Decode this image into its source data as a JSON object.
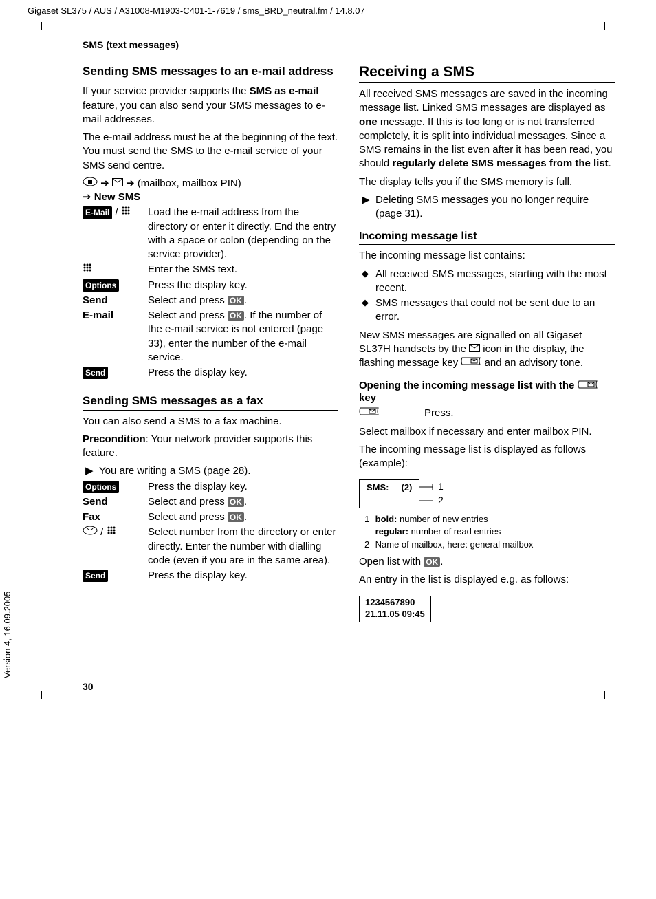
{
  "meta": {
    "path": "Gigaset SL375 / AUS / A31008-M1903-C401-1-7619 / sms_BRD_neutral.fm / 14.8.07",
    "version": "Version 4, 16.09.2005",
    "page_number": "30",
    "section": "SMS (text messages)"
  },
  "left": {
    "h2a": "Sending SMS messages to an e-mail address",
    "p1a": "If your service provider supports the ",
    "p1b": "SMS as e-mail",
    "p1c": " feature, you can also send your SMS messages to e-mail addresses.",
    "p2": "The e-mail address must be at the beginning of the text. You must send the SMS to the e-mail service of your SMS send centre.",
    "nav1": "(mailbox, mailbox PIN)",
    "nav2": "New SMS",
    "email_key": "E-Mail",
    "step1": "Load the e-mail address from the directory or enter it directly. End the entry with a space or colon (depending on the service provider).",
    "step2_label": "",
    "step2": "Enter the SMS text.",
    "step3_label": "Options",
    "step3": "Press the display key.",
    "step4_label": "Send",
    "step4a": "Select and press ",
    "step4b": ".",
    "step5_label": "E-mail",
    "step5a": "Select and press ",
    "step5b": ". If the number of the e-mail service is not entered (page 33), enter the number of the e-mail service.",
    "step6_label": "Send",
    "step6": "Press the display key.",
    "h2b": "Sending SMS messages as a fax",
    "p3": "You can also send a SMS to a fax machine.",
    "p4a": "Precondition",
    "p4b": ": Your network provider supports this feature.",
    "bullet1": "You are writing a SMS (page 28).",
    "fstep1_label": "Options",
    "fstep1": "Press the display key.",
    "fstep2_label": "Send",
    "fstep2a": "Select and press ",
    "fstep2b": ".",
    "fstep3_label": "Fax",
    "fstep3a": "Select and press ",
    "fstep3b": ".",
    "fstep4": "Select number from the directory or enter directly. Enter the number with dialling code (even if you are in the same area).",
    "fstep5_label": "Send",
    "fstep5": "Press the display key.",
    "ok": "OK"
  },
  "right": {
    "h1": "Receiving a SMS",
    "p1a": "All received SMS messages are saved in the incoming message list. Linked SMS messages are displayed as ",
    "p1b": "one",
    "p1c": " message. If this is too long or is not transferred completely, it is split into individual messages. Since a SMS remains in the list even after it has been read, you should ",
    "p1d": "regularly delete SMS messages from the list",
    "p1e": ".",
    "p2": "The display tells you if the SMS memory is full.",
    "bullet1": "Deleting SMS messages you no longer require (page 31).",
    "h3a": "Incoming message list",
    "p3": "The incoming message list contains:",
    "d1": "All received SMS messages, starting with the most recent.",
    "d2": "SMS messages that could not be sent due to an error.",
    "p4a": "New SMS messages are signalled on all Gigaset SL37H handsets by the ",
    "p4b": " icon in the display, the flashing message key ",
    "p4c": " and an advisory tone.",
    "h4a_a": "Opening the incoming message list with the ",
    "h4a_b": " key",
    "press": "Press.",
    "p5": "Select mailbox if necessary and enter mailbox PIN.",
    "p6": "The incoming message list is displayed as follows (example):",
    "disp1_a": "SMS:",
    "disp1_b": "(2)",
    "callout1": "1",
    "callout2": "2",
    "leg1a": "bold:",
    "leg1b": " number of new entries",
    "leg2a": "regular:",
    "leg2b": " number of read entries",
    "leg3": "Name of mailbox, here: general mailbox",
    "open_a": "Open list with ",
    "open_b": ".",
    "p7": "An entry in the list is displayed e.g. as follows:",
    "disp2_a": "1234567890",
    "disp2_b": "21.11.05   09:45",
    "ok": "OK"
  }
}
